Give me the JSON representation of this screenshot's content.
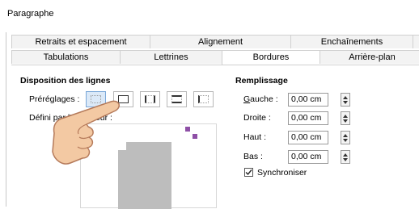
{
  "dialog": {
    "title": "Paragraphe"
  },
  "tabs_row1": [
    "Retraits et espacement",
    "Alignement",
    "Enchaînements"
  ],
  "tabs_row2": [
    "Tabulations",
    "Lettrines",
    "Bordures",
    "Arrière-plan"
  ],
  "line_arrangement": {
    "heading": "Disposition des lignes",
    "presets_label": "Préréglages :",
    "user_defined_label": "Défini par l'utilisateur :"
  },
  "padding": {
    "heading": "Remplissage",
    "left_label": "Gauche :",
    "left_value": "0,00 cm",
    "right_label": "Droite :",
    "right_value": "0,00 cm",
    "top_label": "Haut :",
    "top_value": "0,00 cm",
    "bottom_label": "Bas :",
    "bottom_value": "0,00 cm",
    "sync_label": "Synchroniser",
    "sync_checked": true
  },
  "colors": {
    "preview_gray": "#bdbdbd",
    "marker_purple": "#8e4fa6",
    "hand_fill": "#f3c9a3"
  }
}
